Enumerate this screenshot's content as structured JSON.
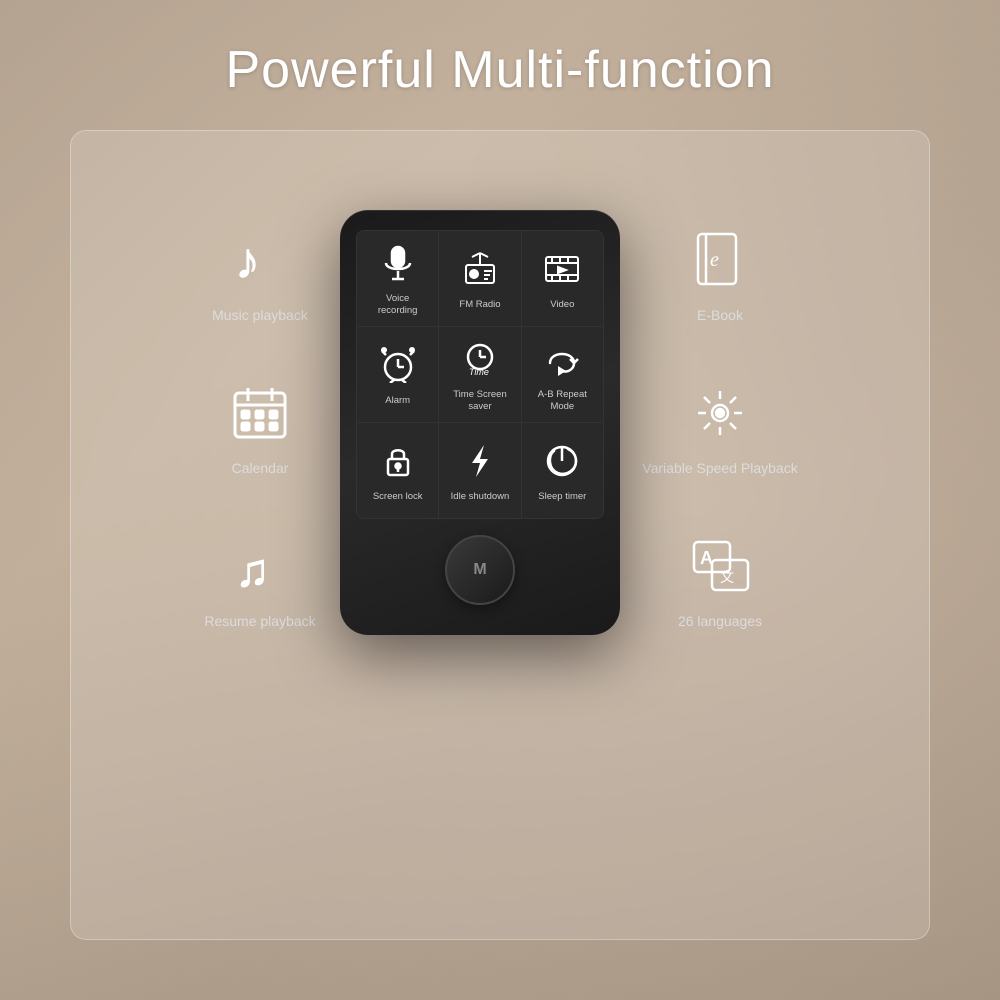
{
  "page": {
    "title": "Powerful Multi-function",
    "background_color": "#b8a898"
  },
  "left_features": [
    {
      "id": "music-playback",
      "label": "Music playback",
      "icon": "music"
    },
    {
      "id": "calendar",
      "label": "Calendar",
      "icon": "calendar"
    },
    {
      "id": "resume-playback",
      "label": "Resume playback",
      "icon": "resume"
    }
  ],
  "right_features": [
    {
      "id": "ebook",
      "label": "E-Book",
      "icon": "book"
    },
    {
      "id": "variable-speed",
      "label": "Variable Speed Playback",
      "icon": "gear"
    },
    {
      "id": "languages",
      "label": "26 languages",
      "icon": "translate"
    }
  ],
  "screen_grid": [
    {
      "id": "voice-recording",
      "label": "Voice recording",
      "icon": "mic"
    },
    {
      "id": "fm-radio",
      "label": "FM Radio",
      "icon": "radio"
    },
    {
      "id": "video",
      "label": "Video",
      "icon": "video"
    },
    {
      "id": "alarm",
      "label": "Alarm",
      "icon": "alarm"
    },
    {
      "id": "time-screen-saver",
      "label": "Time Screen saver",
      "icon": "clock"
    },
    {
      "id": "ab-repeat",
      "label": "A-B Repeat Mode",
      "icon": "repeat"
    },
    {
      "id": "screen-lock",
      "label": "Screen lock",
      "icon": "lock"
    },
    {
      "id": "idle-shutdown",
      "label": "Idle shutdown",
      "icon": "bolt"
    },
    {
      "id": "sleep-timer",
      "label": "Sleep timer",
      "icon": "power"
    }
  ],
  "device": {
    "button_label": "M"
  }
}
